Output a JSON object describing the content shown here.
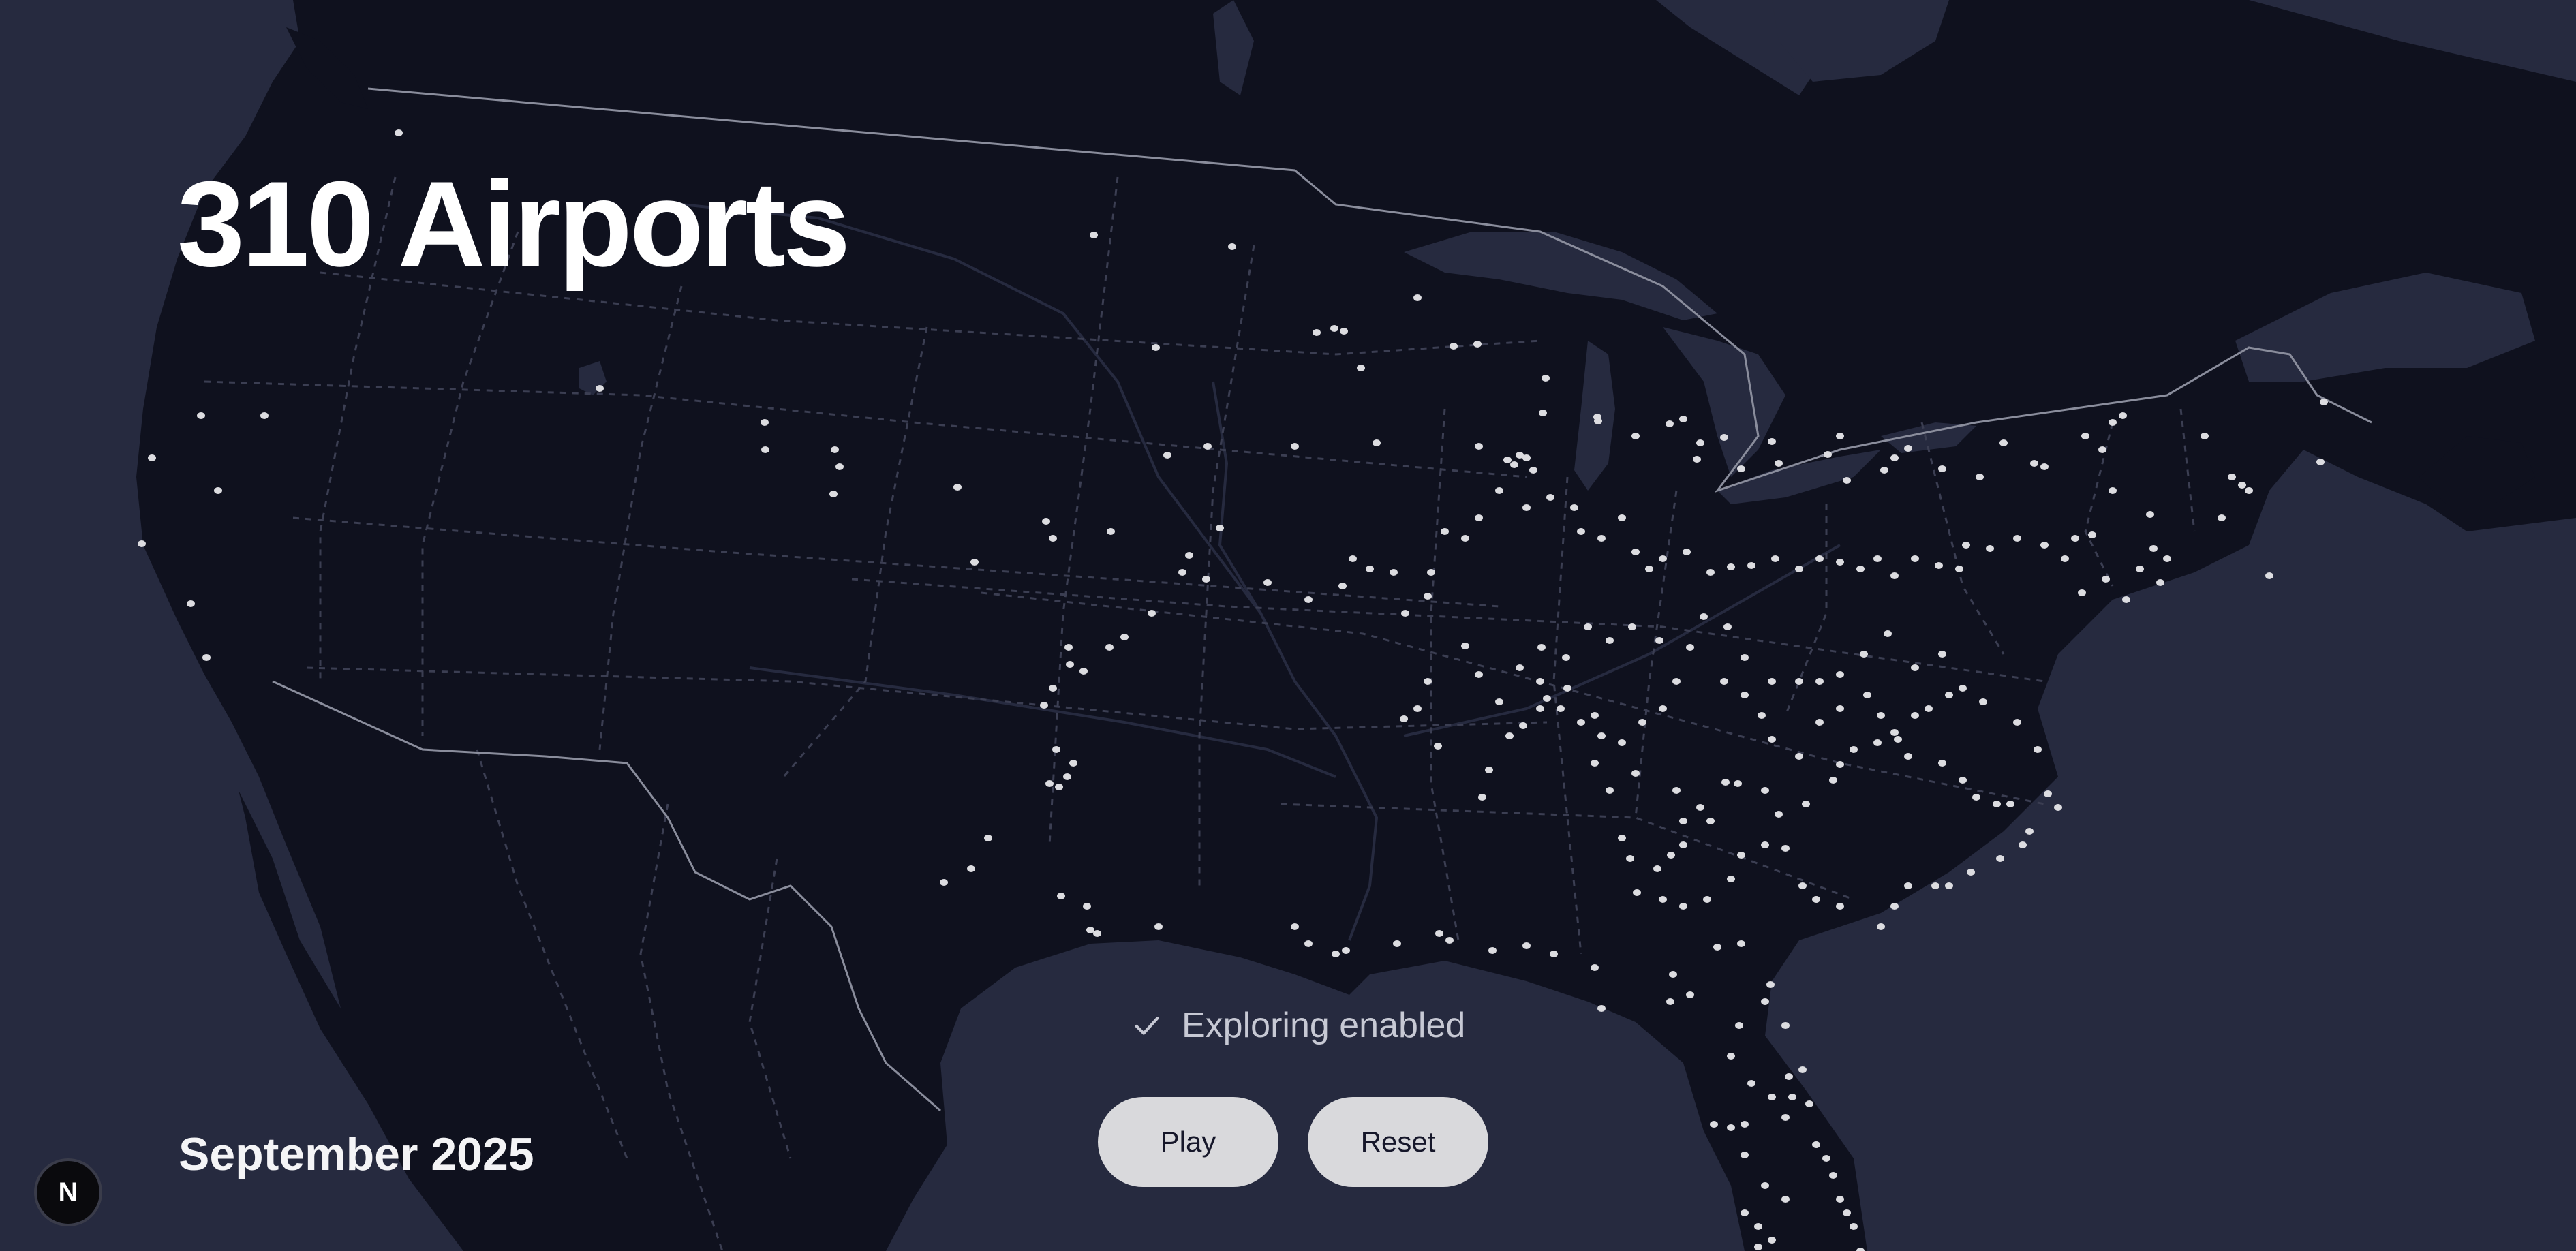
{
  "header": {
    "title": "310 Airports"
  },
  "footer": {
    "date": "September 2025"
  },
  "status": {
    "label": "Exploring enabled",
    "icon": "check-icon"
  },
  "controls": {
    "play_label": "Play",
    "reset_label": "Reset"
  },
  "badge": {
    "label": "N",
    "icon": "next-logo-icon"
  },
  "map": {
    "colors": {
      "ocean": "#262a3f",
      "land": "#0f111e",
      "lake": "#262a3f",
      "national_border": "#8a8d9c",
      "state_border": "#3b3e52",
      "river": "#2a2d42",
      "airport": "#dcdce0"
    },
    "airport_count": 310
  }
}
